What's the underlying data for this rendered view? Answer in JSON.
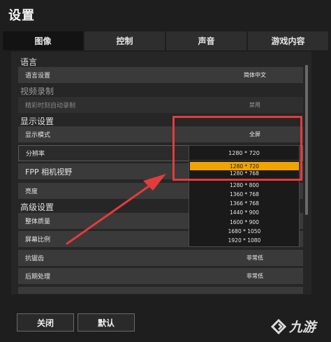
{
  "title": "设置",
  "tabs": [
    {
      "label": "图像",
      "active": true
    },
    {
      "label": "控制",
      "active": false
    },
    {
      "label": "声音",
      "active": false
    },
    {
      "label": "游戏内容",
      "active": false
    }
  ],
  "sections": {
    "language": "语言",
    "video_recording": "视频录制",
    "display_settings": "显示设置",
    "advanced_settings": "高级设置"
  },
  "rows": {
    "language_setting": {
      "label": "语言设置",
      "value": "简体中文"
    },
    "highlight_record": {
      "label": "精彩时刻自动录制",
      "value": "禁用"
    },
    "display_mode": {
      "label": "显示模式",
      "value": "全屏"
    },
    "resolution": {
      "label": "分辨率"
    },
    "fpp_fov": {
      "label": "FPP 相机视野"
    },
    "brightness": {
      "label": "亮度"
    },
    "overall_quality": {
      "label": "整体质量"
    },
    "screen_ratio": {
      "label": "屏幕比例"
    },
    "anti_aliasing": {
      "label": "抗锯齿",
      "value": "非常低"
    },
    "post_processing": {
      "label": "后期处理",
      "value": "非常低"
    }
  },
  "resolution_dropdown": {
    "current": "1280 * 720",
    "options": [
      "1280 * 720",
      "1280 * 768",
      "1280 * 800",
      "1360 * 768",
      "1366 * 768",
      "1440 * 900",
      "1600 * 900",
      "1680 * 1050",
      "1920 * 1080"
    ],
    "highlighted_index": 0
  },
  "buttons": {
    "close": "关闭",
    "default": "默认"
  },
  "watermark": {
    "text": "九游"
  },
  "colors": {
    "highlight": "#f0a400",
    "annotation": "#e43b3b"
  },
  "icons": {
    "watermark": "nine-game-logo-icon"
  }
}
